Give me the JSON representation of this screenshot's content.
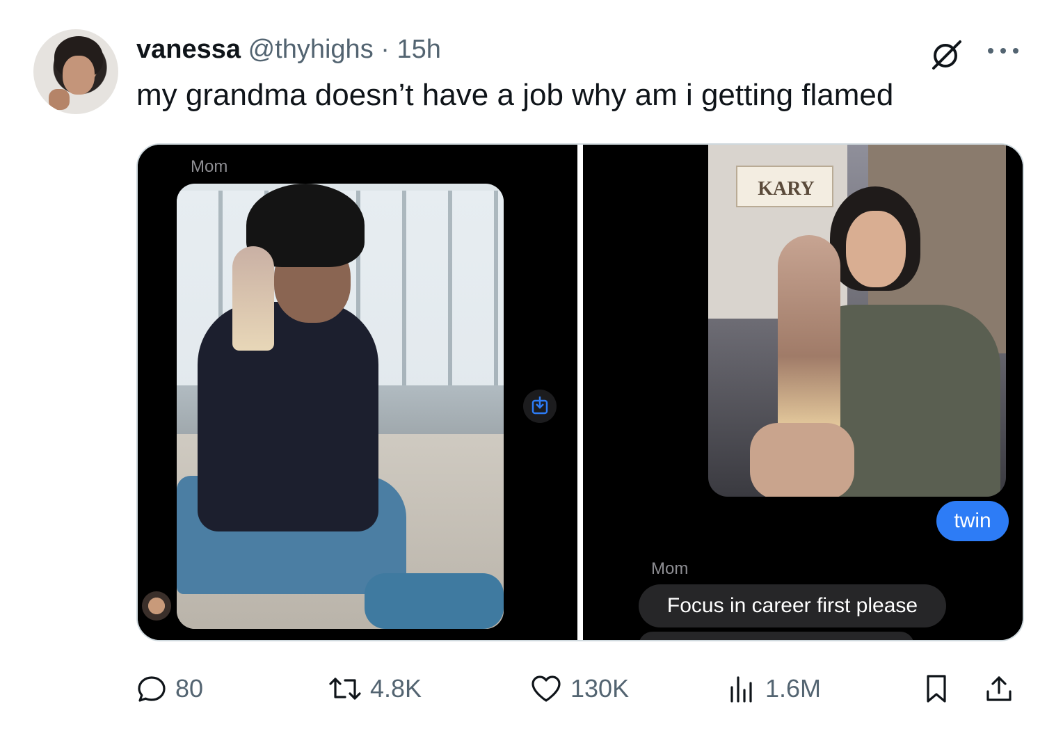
{
  "tweet": {
    "name": "vanessa",
    "handle": "@thyhighs",
    "separator": "·",
    "time": "15h",
    "text": "my grandma doesn’t have a job why am i getting flamed"
  },
  "media": {
    "left": {
      "sender": "Mom"
    },
    "right": {
      "shop_sign": "KARY",
      "reply_text": "twin",
      "sender": "Mom",
      "message_text": "Focus in career first please"
    }
  },
  "actions": {
    "replies": "80",
    "reposts": "4.8K",
    "likes": "130K",
    "views": "1.6M"
  },
  "icons": {
    "more": "more-icon",
    "grok": "grok-icon",
    "reply": "reply-icon",
    "repost": "repost-icon",
    "like": "heart-icon",
    "views": "views-icon",
    "bookmark": "bookmark-icon",
    "share": "share-icon",
    "save": "download-icon"
  },
  "colors": {
    "text": "#0f1419",
    "secondary": "#536471",
    "imessage_blue": "#2d7cf6",
    "imessage_gray": "#262628"
  }
}
